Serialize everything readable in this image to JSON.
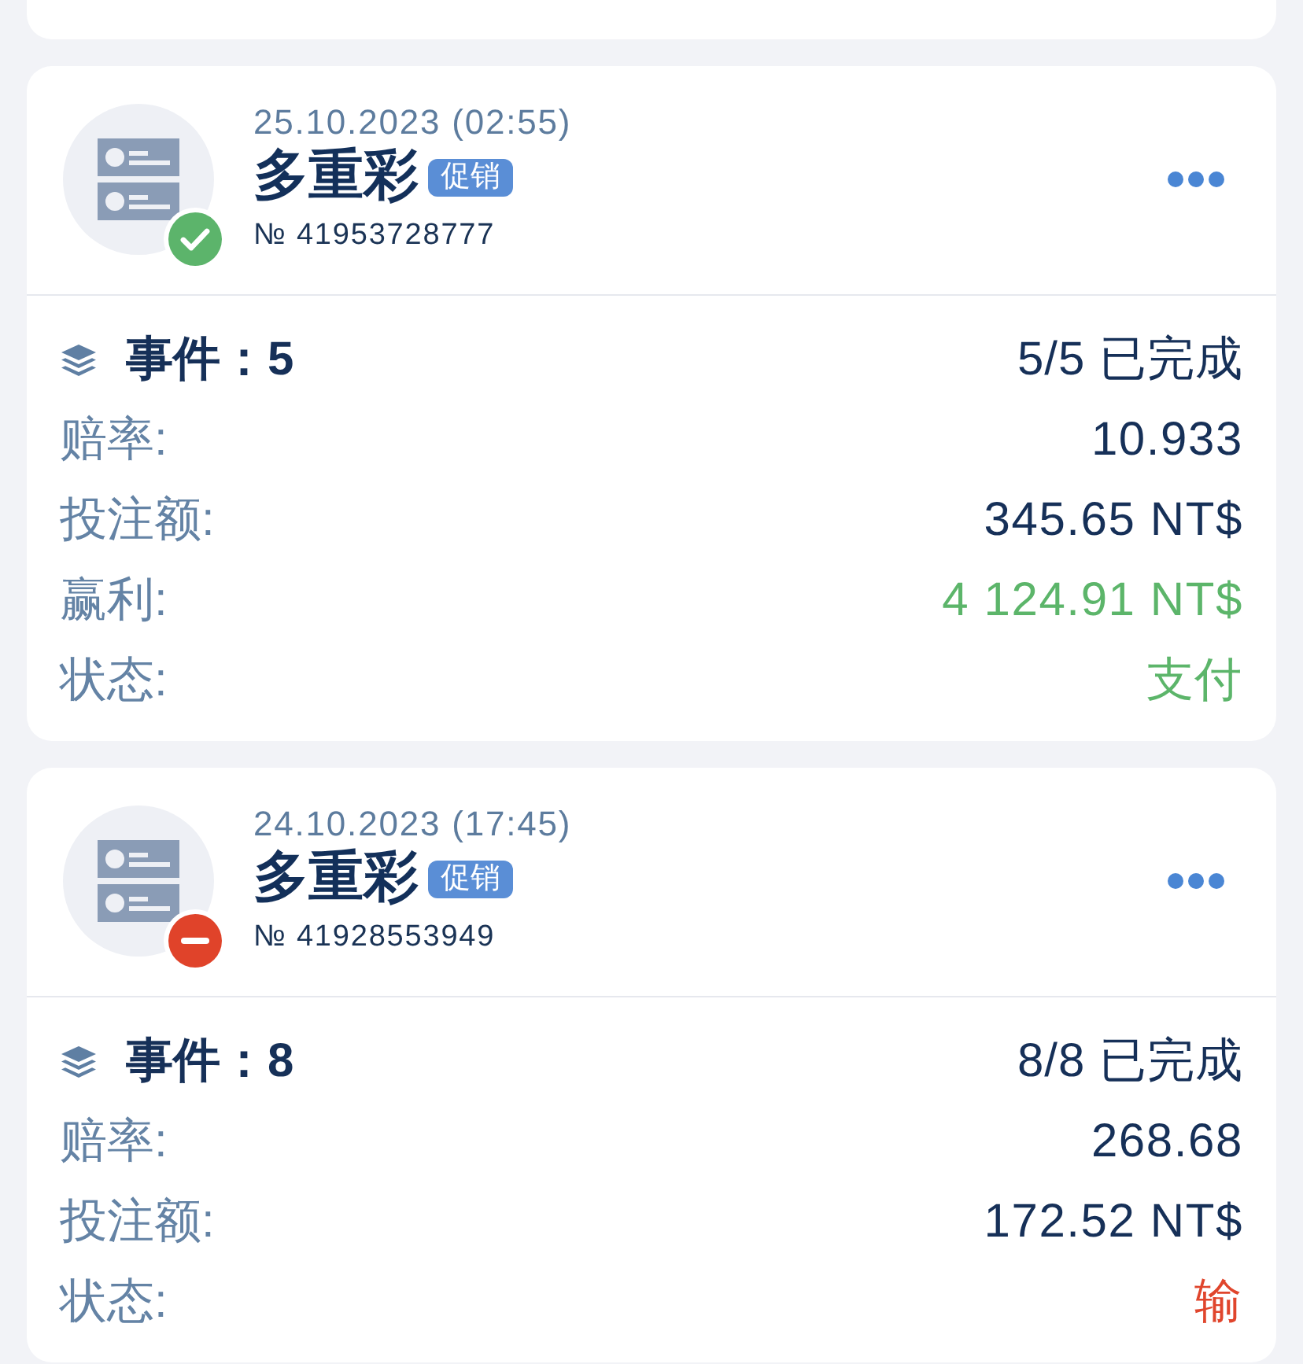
{
  "tickets": [
    {
      "date": "25.10.2023 (02:55)",
      "title": "多重彩",
      "tag": "促销",
      "number": "№ 41953728777",
      "won": true,
      "events": {
        "label": "事件：5",
        "progress": "5/5 已完成",
        "completed": true
      },
      "rows": [
        {
          "label": "赔率:",
          "value": "10.933"
        },
        {
          "label": "投注额:",
          "value": "345.65 NT$"
        },
        {
          "label": "赢利:",
          "value": "4 124.91 NT$",
          "color": "#5cb56a"
        },
        {
          "label": "状态:",
          "value": "支付",
          "color": "#5cb56a"
        }
      ]
    },
    {
      "date": "24.10.2023 (17:45)",
      "title": "多重彩",
      "tag": "促销",
      "number": "№ 41928553949",
      "won": false,
      "events": {
        "label": "事件：8",
        "progress": "8/8 已完成",
        "completed": true
      },
      "rows": [
        {
          "label": "赔率:",
          "value": "268.68"
        },
        {
          "label": "投注额:",
          "value": "172.52 NT$"
        },
        {
          "label": "状态:",
          "value": "输",
          "color": "#e0452c"
        }
      ]
    }
  ]
}
